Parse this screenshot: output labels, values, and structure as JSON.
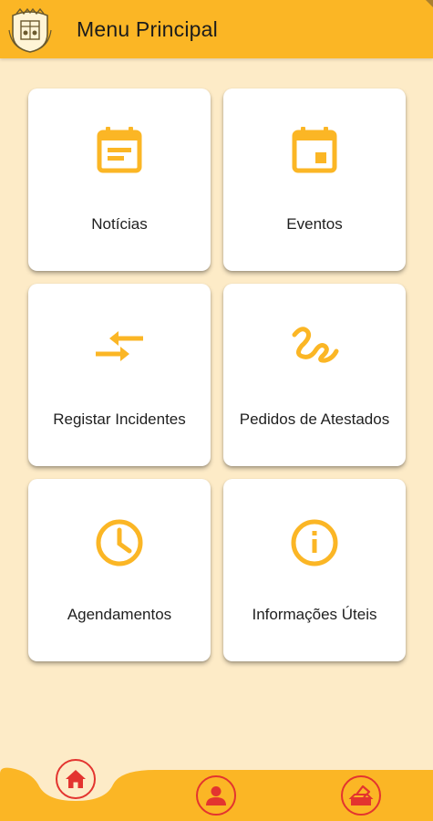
{
  "header": {
    "title": "Menu Principal",
    "logo_icon": "coat-of-arms-icon"
  },
  "menu": {
    "items": [
      {
        "label": "Notícias",
        "icon": "newspaper-icon"
      },
      {
        "label": "Eventos",
        "icon": "event-calendar-icon"
      },
      {
        "label": "Registar Incidentes",
        "icon": "compare-arrows-icon"
      },
      {
        "label": "Pedidos de Atestados",
        "icon": "gesture-icon"
      },
      {
        "label": "Agendamentos",
        "icon": "clock-icon"
      },
      {
        "label": "Informações Úteis",
        "icon": "info-icon"
      }
    ]
  },
  "bottom_nav": {
    "items": [
      {
        "name": "home",
        "icon": "home-icon",
        "active": true
      },
      {
        "name": "profile",
        "icon": "person-icon",
        "active": false
      },
      {
        "name": "vote",
        "icon": "ballot-box-icon",
        "active": false
      }
    ]
  },
  "colors": {
    "accent": "#fbb625",
    "background": "#fdebc7",
    "nav_icon": "#e3342f",
    "card": "#ffffff"
  }
}
